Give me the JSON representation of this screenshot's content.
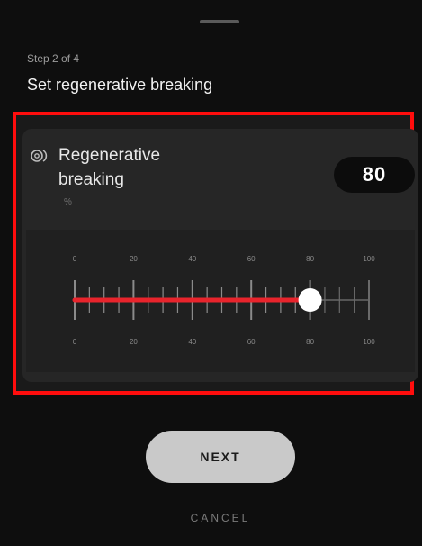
{
  "header": {
    "step": "Step 2 of 4",
    "title": "Set regenerative breaking"
  },
  "setting": {
    "icon": "regen-icon",
    "label": "Regenerative breaking",
    "unit": "%",
    "value": "80",
    "value_number": 80,
    "min": 0,
    "max": 100
  },
  "slider": {
    "ticks_top": [
      "0",
      "20",
      "40",
      "60",
      "80",
      "100"
    ],
    "ticks_bottom": [
      "0",
      "20",
      "40",
      "60",
      "80",
      "100"
    ],
    "fill_color": "#e8242c",
    "thumb_color": "#ffffff"
  },
  "actions": {
    "next_label": "NEXT",
    "cancel_label": "CANCEL"
  },
  "highlight_color": "#ff0d0d"
}
